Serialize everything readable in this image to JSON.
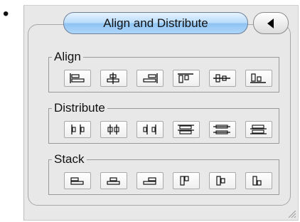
{
  "panel": {
    "title": "Align and Distribute"
  },
  "sections": [
    {
      "label": "Align",
      "buttons": [
        {
          "name": "align-left-edges-button",
          "icon": "align-left-edges-icon"
        },
        {
          "name": "align-horizontal-centers-button",
          "icon": "align-horizontal-centers-icon"
        },
        {
          "name": "align-right-edges-button",
          "icon": "align-right-edges-icon"
        },
        {
          "name": "align-top-edges-button",
          "icon": "align-top-edges-icon"
        },
        {
          "name": "align-vertical-centers-button",
          "icon": "align-vertical-centers-icon"
        },
        {
          "name": "align-bottom-edges-button",
          "icon": "align-bottom-edges-icon"
        }
      ]
    },
    {
      "label": "Distribute",
      "buttons": [
        {
          "name": "distribute-left-edges-button",
          "icon": "distribute-left-edges-icon"
        },
        {
          "name": "distribute-horizontal-centers-button",
          "icon": "distribute-horizontal-centers-icon"
        },
        {
          "name": "distribute-right-edges-button",
          "icon": "distribute-right-edges-icon"
        },
        {
          "name": "distribute-top-edges-button",
          "icon": "distribute-top-edges-icon"
        },
        {
          "name": "distribute-vertical-centers-button",
          "icon": "distribute-vertical-centers-icon"
        },
        {
          "name": "distribute-bottom-edges-button",
          "icon": "distribute-bottom-edges-icon"
        }
      ]
    },
    {
      "label": "Stack",
      "buttons": [
        {
          "name": "stack-left-button",
          "icon": "stack-left-icon"
        },
        {
          "name": "stack-center-button",
          "icon": "stack-center-icon"
        },
        {
          "name": "stack-right-button",
          "icon": "stack-right-icon"
        },
        {
          "name": "stack-top-button",
          "icon": "stack-top-icon"
        },
        {
          "name": "stack-middle-button",
          "icon": "stack-middle-icon"
        },
        {
          "name": "stack-bottom-button",
          "icon": "stack-bottom-icon"
        }
      ]
    }
  ]
}
